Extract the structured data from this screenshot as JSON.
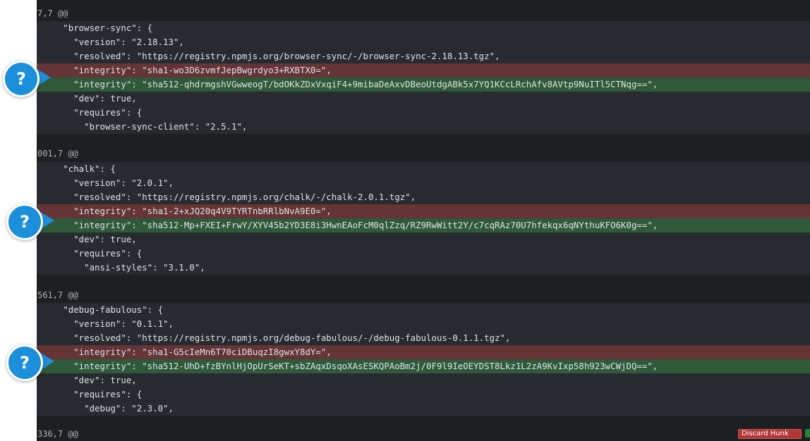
{
  "hunks": [
    {
      "header": "7,7 @@",
      "lines": [
        {
          "type": "context",
          "text": "     \"browser-sync\": {"
        },
        {
          "type": "context",
          "text": "       \"version\": \"2.18.13\","
        },
        {
          "type": "context",
          "text": "       \"resolved\": \"https://registry.npmjs.org/browser-sync/-/browser-sync-2.18.13.tgz\","
        },
        {
          "type": "del",
          "text": "       \"integrity\": \"sha1-wo3D6zvmfJepBwgrdyo3+RXBTX0=\","
        },
        {
          "type": "add",
          "text": "       \"integrity\": \"sha512-qhdrmgshVGwweogT/bdOKkZDxVxqiF4+9mibaDeAxvDBeoUtdgABk5x7YQ1KCcLRchAfv8AVtp9NuITl5CTNqg==\","
        },
        {
          "type": "context",
          "text": "       \"dev\": true,"
        },
        {
          "type": "context",
          "text": "       \"requires\": {"
        },
        {
          "type": "context",
          "text": "         \"browser-sync-client\": \"2.5.1\","
        }
      ]
    },
    {
      "header": "001,7 @@",
      "lines": [
        {
          "type": "context",
          "text": "     \"chalk\": {"
        },
        {
          "type": "context",
          "text": "       \"version\": \"2.0.1\","
        },
        {
          "type": "context",
          "text": "       \"resolved\": \"https://registry.npmjs.org/chalk/-/chalk-2.0.1.tgz\","
        },
        {
          "type": "del",
          "text": "       \"integrity\": \"sha1-2+xJQ20q4V9TYRTnbRRlbNvA9E0=\","
        },
        {
          "type": "add",
          "text": "       \"integrity\": \"sha512-Mp+FXEI+FrwY/XYV45b2YD3E8i3HwnEAoFcM0qlZzq/RZ9RwWitt2Y/c7cqRAz70U7hfekqx6qNYthuKFO6K0g==\","
        },
        {
          "type": "context",
          "text": "       \"dev\": true,"
        },
        {
          "type": "context",
          "text": "       \"requires\": {"
        },
        {
          "type": "context",
          "text": "         \"ansi-styles\": \"3.1.0\","
        }
      ]
    },
    {
      "header": "561,7 @@",
      "lines": [
        {
          "type": "context",
          "text": "     \"debug-fabulous\": {"
        },
        {
          "type": "context",
          "text": "       \"version\": \"0.1.1\","
        },
        {
          "type": "context",
          "text": "       \"resolved\": \"https://registry.npmjs.org/debug-fabulous/-/debug-fabulous-0.1.1.tgz\","
        },
        {
          "type": "del",
          "text": "       \"integrity\": \"sha1-G5cIeMn6T70ciDBuqzI8gwxY8dY=\","
        },
        {
          "type": "add",
          "text": "       \"integrity\": \"sha512-UhD+fzBYnlHjOpUrSeKT+sbZAqxDsqoXAsESKQPAoBm2j/0F9l9IeOEYDST8Lkz1L2zA9KvIxp58h923wCWjDQ==\","
        },
        {
          "type": "context",
          "text": "       \"dev\": true,"
        },
        {
          "type": "context",
          "text": "       \"requires\": {"
        },
        {
          "type": "context",
          "text": "         \"debug\": \"2.3.0\","
        }
      ]
    },
    {
      "header": "336,7 @@",
      "lines": []
    }
  ],
  "help_badges": [
    {
      "symbol": "?",
      "icon": "question-mark-icon"
    },
    {
      "symbol": "?",
      "icon": "question-mark-icon"
    },
    {
      "symbol": "?",
      "icon": "question-mark-icon"
    }
  ],
  "footer": {
    "discard_label": "Discard Hunk"
  },
  "colors": {
    "background": "#1d2023",
    "context_line": "#272b2f",
    "deleted_line": "#643436",
    "added_line": "#2e5a3a",
    "badge": "#1c8fdb"
  }
}
